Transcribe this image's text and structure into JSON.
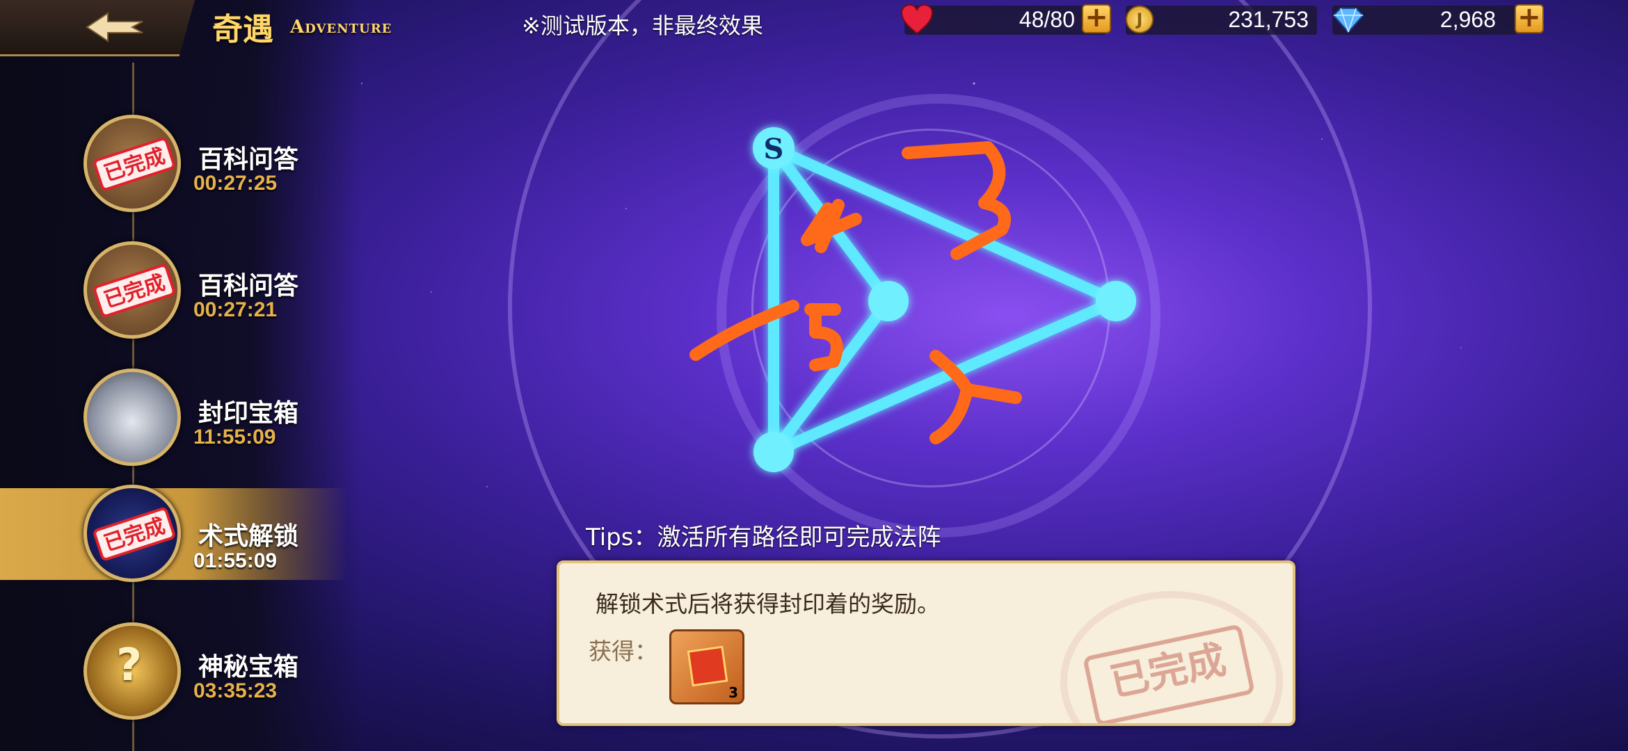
{
  "header": {
    "title_cn": "奇遇",
    "title_en": "Adventure",
    "notice": "※测试版本，非最终效果"
  },
  "resources": {
    "stamina": {
      "value": "48/80",
      "icon": "heart-icon"
    },
    "gold": {
      "value": "231,753",
      "icon": "coin-icon"
    },
    "gems": {
      "value": "2,968",
      "icon": "diamond-icon"
    }
  },
  "sidebar": {
    "items": [
      {
        "name": "百科问答",
        "time": "00:27:25",
        "stamp": "已完成",
        "icon": "book-icon"
      },
      {
        "name": "百科问答",
        "time": "00:27:21",
        "stamp": "已完成",
        "icon": "book-icon"
      },
      {
        "name": "封印宝箱",
        "time": "11:55:09",
        "stamp": "",
        "icon": "silver-chest-icon"
      },
      {
        "name": "术式解锁",
        "time": "01:55:09",
        "stamp": "已完成",
        "icon": "magic-orb-icon"
      },
      {
        "name": "神秘宝箱",
        "time": "03:35:23",
        "stamp": "",
        "icon": "mystery-chest-icon"
      }
    ]
  },
  "puzzle": {
    "start_label": "S",
    "annotations": [
      "3",
      "4",
      "5",
      "1",
      "2"
    ],
    "tips": "Tips：激活所有路径即可完成法阵"
  },
  "panel": {
    "description": "解锁术式后将获得封印着的奖励。",
    "get_label": "获得：",
    "reward_count": "3",
    "stamp": "已完成"
  },
  "colors": {
    "accent_gold": "#e8b24a",
    "line_cyan": "#5fe9ff",
    "annotation_orange": "#ff6a1a",
    "stamp_red": "#e0212a"
  }
}
